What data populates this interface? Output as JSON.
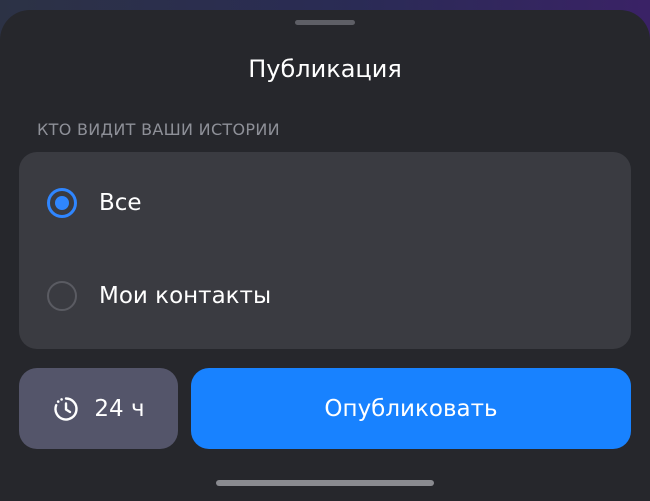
{
  "sheet": {
    "title": "Публикация"
  },
  "privacy": {
    "section_label": "КТО ВИДИТ ВАШИ ИСТОРИИ",
    "options": [
      {
        "label": "Все",
        "selected": true
      },
      {
        "label": "Мои контакты",
        "selected": false
      }
    ]
  },
  "actions": {
    "duration_label": "24 ч",
    "duration_icon": "clock-icon",
    "publish_label": "Опубликовать"
  },
  "colors": {
    "accent": "#1882ff",
    "sheet_background": "#26272c",
    "card_background": "#3a3b41",
    "duration_button": "#54556a"
  }
}
